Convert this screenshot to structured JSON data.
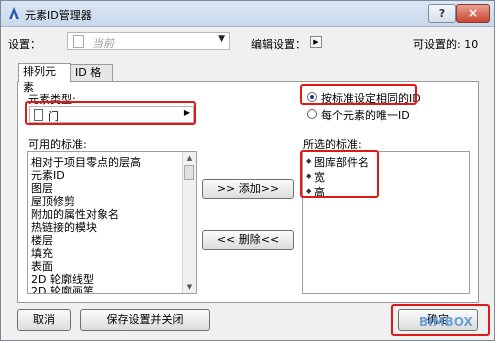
{
  "window": {
    "title": "元素ID管理器",
    "help": "?",
    "close": "×"
  },
  "settings": {
    "label": "设置：",
    "value": "当前",
    "edit_label": "编辑设置：",
    "count_label": "可设置的: 10"
  },
  "tabs": [
    "排列元素",
    "ID 格式"
  ],
  "element_type": {
    "label": "元素类型:",
    "value": "门"
  },
  "radios": [
    {
      "label": "按标准设定相同的ID",
      "checked": true
    },
    {
      "label": "每个元素的唯一ID",
      "checked": false
    }
  ],
  "available": {
    "label": "可用的标准:",
    "items": [
      "相对于项目零点的层高",
      "元素ID",
      "图层",
      "屋顶修剪",
      "附加的属性对象名",
      "热链接的模块",
      "楼层",
      "填充",
      "表面",
      "2D 轮廓线型",
      "2D 轮廓画笔"
    ]
  },
  "selected": {
    "label": "所选的标准:",
    "items": [
      "图库部件名",
      "宽",
      "高"
    ]
  },
  "buttons": {
    "add": ">> 添加>>",
    "remove": "<< 删除<<",
    "cancel": "取消",
    "save_close": "保存设置并关闭",
    "ok": "确定"
  },
  "watermark": "BIMBOX",
  "colors": {
    "highlight": "#e01818"
  }
}
